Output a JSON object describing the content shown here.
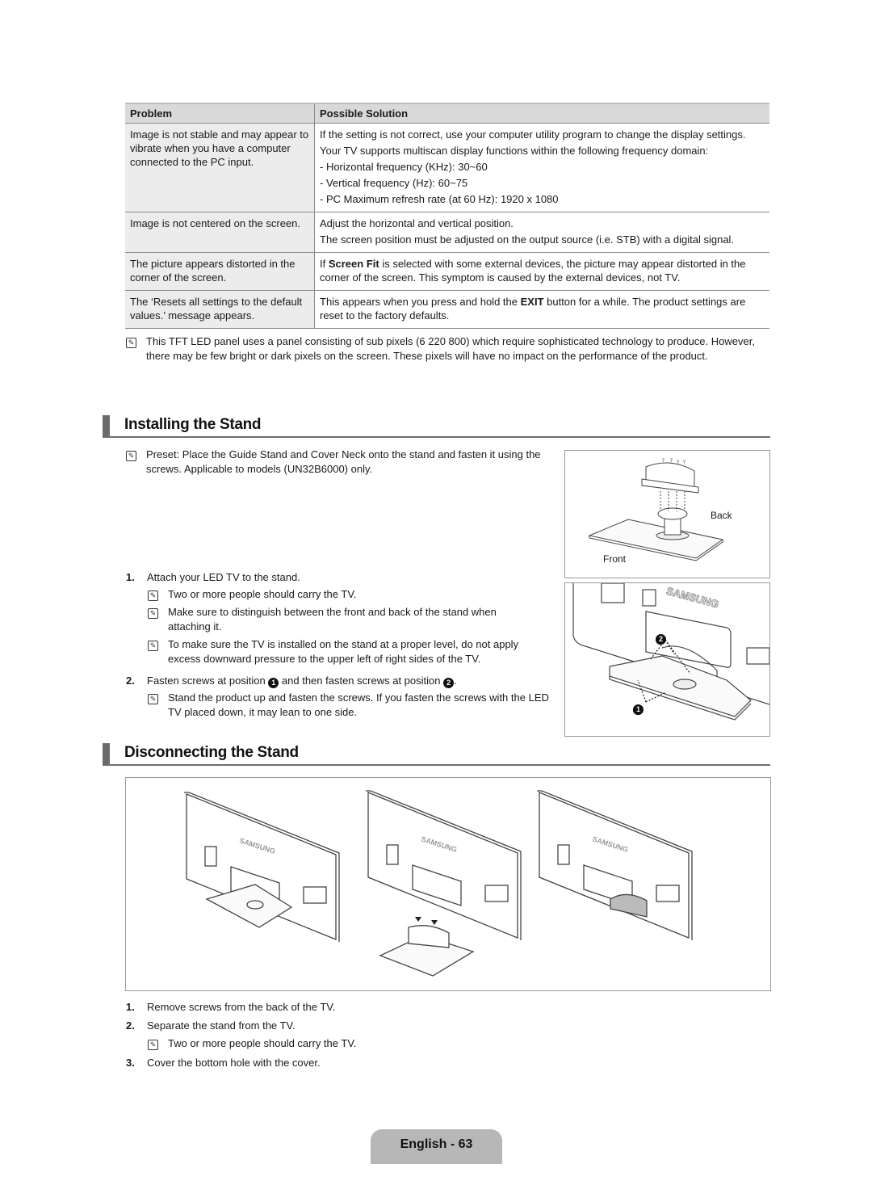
{
  "table": {
    "headers": {
      "problem": "Problem",
      "solution": "Possible Solution"
    },
    "rows": [
      {
        "problem": "Image is not stable and may appear to vibrate when you have a computer connected to the PC input.",
        "solution_lines": [
          "If the setting is not correct, use your computer utility program to change the display settings.",
          "Your TV supports multiscan display functions within the following frequency domain:",
          "- Horizontal frequency (KHz): 30~60",
          "- Vertical frequency (Hz): 60~75",
          "- PC Maximum refresh rate (at 60 Hz): 1920 x 1080"
        ]
      },
      {
        "problem": "Image is not centered on the screen.",
        "solution_lines": [
          "Adjust the horizontal and vertical position.",
          "The screen position must be adjusted on the output source (i.e. STB) with a digital signal."
        ]
      },
      {
        "problem": "The picture appears distorted in the corner of the screen.",
        "solution_pre": "If ",
        "solution_bold": "Screen Fit",
        "solution_post": " is selected with some external devices, the picture may appear distorted in the corner of the screen. This symptom is caused by the external devices, not TV."
      },
      {
        "problem": "The ‘Resets all settings to the default values.’ message appears.",
        "solution_pre": "This appears when you press and hold the ",
        "solution_bold": "EXIT",
        "solution_post": " button for a while. The product settings are reset to the factory defaults."
      }
    ]
  },
  "panel_note": "This TFT LED panel uses a panel consisting of sub pixels (6 220 800) which require sophisticated technology to produce. However, there may be few bright or dark pixels on the screen. These pixels will have no impact on the performance of the product.",
  "installing": {
    "title": "Installing the Stand",
    "preset_note": "Preset: Place the Guide Stand and Cover Neck onto the stand and fasten it using the screws. Applicable to models (UN32B6000) only.",
    "steps": [
      {
        "num": "1.",
        "text": "Attach your LED TV to the stand.",
        "notes": [
          "Two or more people should carry the TV.",
          "Make sure to distinguish between the front and back of the stand when attaching it.",
          "To make sure the TV is installed on the stand at a proper level, do not apply excess downward pressure to the upper left of right sides of the TV."
        ]
      },
      {
        "num": "2.",
        "text_pre": "Fasten screws at position ",
        "pos1": "1",
        "text_mid": " and then fasten screws at position ",
        "pos2": "2",
        "text_post": ".",
        "notes": [
          "Stand the product up and fasten the screws. If you fasten the screws with the LED TV placed down, it may lean to one side."
        ]
      }
    ],
    "figure": {
      "label_back": "Back",
      "label_front": "Front",
      "brand": "SAMSUNG",
      "marker1": "1",
      "marker2": "2"
    }
  },
  "disconnecting": {
    "title": "Disconnecting the Stand",
    "figure": {
      "brand": "SAMSUNG"
    },
    "steps": [
      {
        "num": "1.",
        "text": "Remove screws from the back of the TV."
      },
      {
        "num": "2.",
        "text": "Separate the stand from the TV.",
        "notes": [
          "Two or more people should carry the TV."
        ]
      },
      {
        "num": "3.",
        "text": "Cover the bottom hole with the cover."
      }
    ]
  },
  "footer": {
    "page_label": "English - 63"
  }
}
